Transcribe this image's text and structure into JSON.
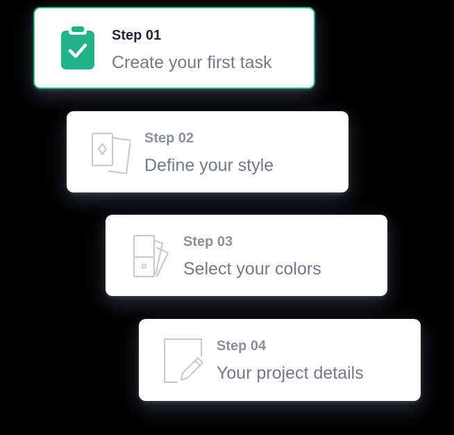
{
  "accent_color": "#22b388",
  "steps": [
    {
      "label": "Step 01",
      "title": "Create your first task",
      "icon": "clipboard-check-icon",
      "active": true
    },
    {
      "label": "Step 02",
      "title": "Define your style",
      "icon": "style-cards-icon",
      "active": false
    },
    {
      "label": "Step 03",
      "title": "Select your colors",
      "icon": "color-swatches-icon",
      "active": false
    },
    {
      "label": "Step 04",
      "title": "Your project details",
      "icon": "document-edit-icon",
      "active": false
    }
  ]
}
